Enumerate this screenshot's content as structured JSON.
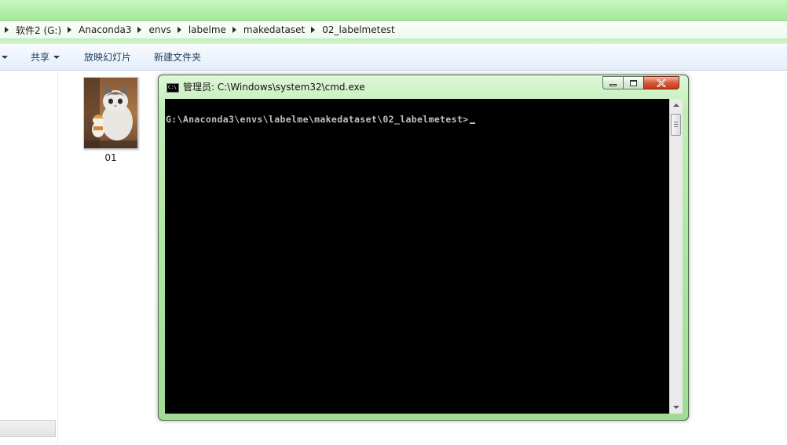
{
  "explorer": {
    "breadcrumb": [
      "软件2 (G:)",
      "Anaconda3",
      "envs",
      "labelme",
      "makedataset",
      "02_labelmetest"
    ],
    "toolbar": {
      "share_label": "共享",
      "slideshow_label": "放映幻灯片",
      "new_folder_label": "新建文件夹"
    },
    "files": [
      {
        "name": "01",
        "icon": "cat-image-thumbnail"
      }
    ]
  },
  "cmd": {
    "title": "管理员: C:\\Windows\\system32\\cmd.exe",
    "icon_text": "C:\\",
    "prompt": "G:\\Anaconda3\\envs\\labelme\\makedataset\\02_labelmetest>",
    "colors": {
      "console_bg": "#000000",
      "console_text": "#c0c0c0",
      "frame": "#aee6a3"
    }
  }
}
